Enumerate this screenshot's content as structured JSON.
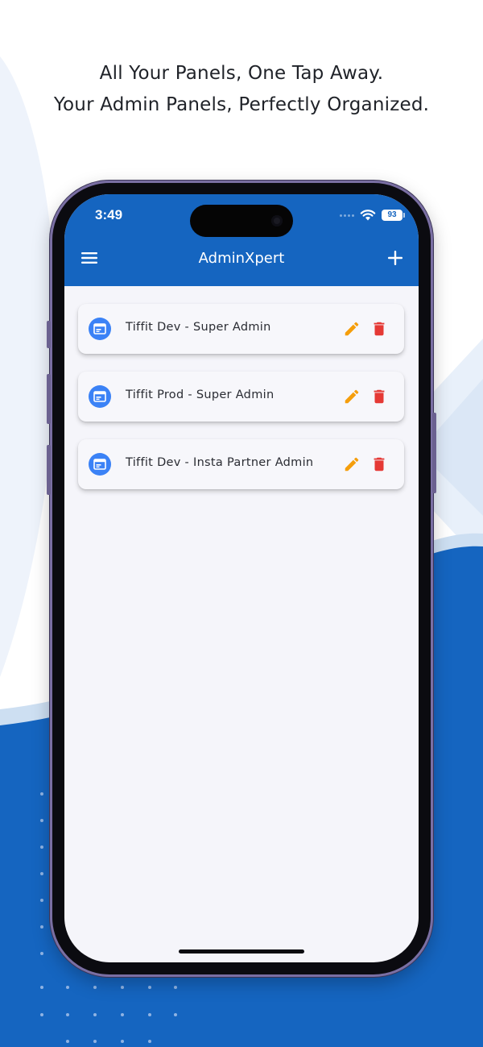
{
  "headline": {
    "line1": "All Your Panels, One Tap Away.",
    "line2": "Your Admin Panels, Perfectly Organized."
  },
  "status_bar": {
    "time": "3:49",
    "battery": "93"
  },
  "app_bar": {
    "title": "AdminXpert",
    "menu_icon": "hamburger-menu-icon",
    "add_icon": "plus-icon"
  },
  "panels": [
    {
      "label": "Tiffit Dev - Super Admin"
    },
    {
      "label": "Tiffit Prod - Super Admin"
    },
    {
      "label": "Tiffit Dev - Insta Partner Admin"
    }
  ],
  "colors": {
    "primary": "#1565c0",
    "panel_icon": "#3b82f6",
    "edit": "#f59e0b",
    "delete": "#e53935",
    "screen_bg": "#f5f5fa"
  }
}
